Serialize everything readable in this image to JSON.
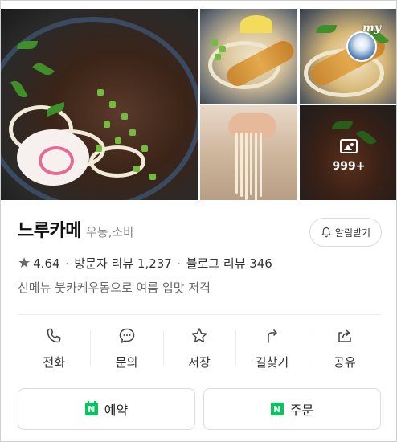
{
  "photos": {
    "more_count": "999+",
    "my_badge": "my"
  },
  "place": {
    "name": "느루카메",
    "category": "우동,소바",
    "rating": "4.64",
    "visitor_reviews": "방문자 리뷰 1,237",
    "blog_reviews": "블로그 리뷰 346",
    "description": "신메뉴 붓카케우동으로 여름 입맛 저격"
  },
  "alarm": {
    "label": "알림받기",
    "icon": "bell-icon"
  },
  "actions": [
    {
      "label": "전화",
      "icon": "phone-icon"
    },
    {
      "label": "문의",
      "icon": "chat-icon"
    },
    {
      "label": "저장",
      "icon": "star-outline-icon"
    },
    {
      "label": "길찾기",
      "icon": "directions-icon"
    },
    {
      "label": "공유",
      "icon": "share-icon"
    }
  ],
  "bottom_buttons": [
    {
      "label": "예약",
      "icon": "naver-calendar-icon",
      "logo": "N"
    },
    {
      "label": "주문",
      "icon": "naver-logo-icon",
      "logo": "N"
    }
  ],
  "colors": {
    "naver_green": "#03c75a",
    "text_primary": "#111111",
    "text_secondary": "#8a8a8a"
  }
}
